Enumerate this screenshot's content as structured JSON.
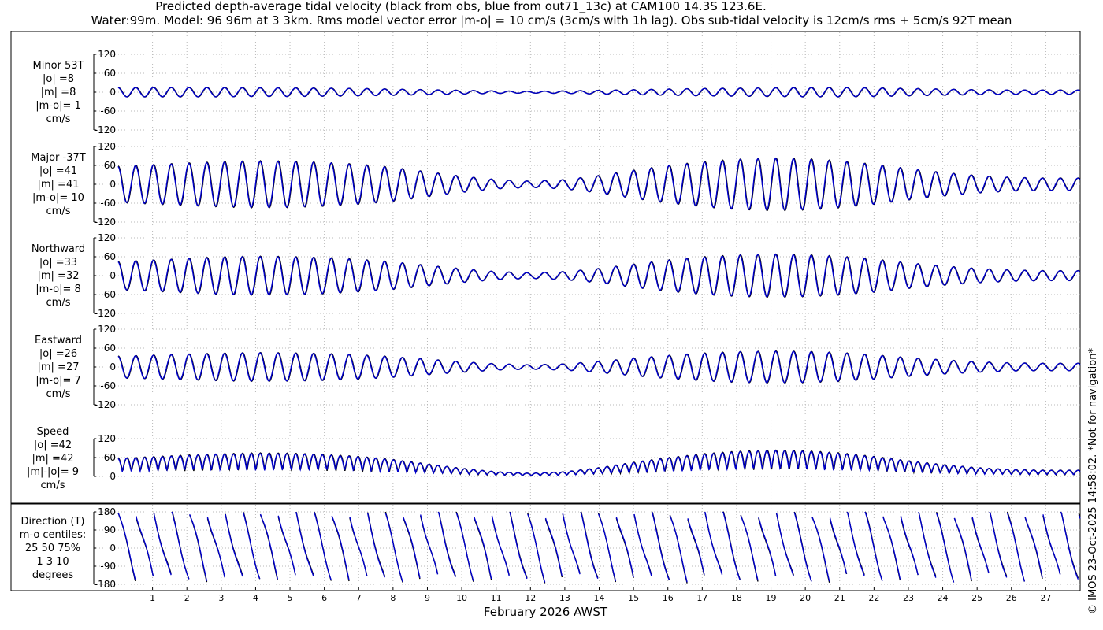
{
  "title_line1": "Predicted depth-average tidal velocity (black from obs, blue from out71_13c) at CAM100 14.3S 123.6E.",
  "title_line2": "Water:99m. Model: 96 96m at 3 3km. Rms model vector error |m-o| = 10 cm/s (3cm/s with 1h lag). Obs sub-tidal velocity is 12cm/s rms + 5cm/s 92T mean",
  "credit": "© IMOS 23-Oct-2025 14:58:02. *Not for navigation*",
  "panels": [
    {
      "lines": [
        "Minor 53T",
        "|o| =8",
        "|m| =8",
        "|m-o|= 1",
        "cm/s"
      ]
    },
    {
      "lines": [
        "Major -37T",
        "|o| =41",
        "|m| =41",
        "|m-o|= 10",
        "cm/s"
      ]
    },
    {
      "lines": [
        "Northward",
        "|o| =33",
        "|m| =32",
        "|m-o|= 8",
        "cm/s"
      ]
    },
    {
      "lines": [
        "Eastward",
        "|o| =26",
        "|m| =27",
        "|m-o|= 7",
        "cm/s"
      ]
    },
    {
      "lines": [
        "Speed",
        "|o| =42",
        "|m| =42",
        "|m|-|o|= 9",
        "cm/s"
      ]
    },
    {
      "lines": [
        "Direction (T)",
        "m-o centiles:",
        "25  50  75%",
        "1   3  10",
        "degrees"
      ]
    }
  ],
  "chart_data": {
    "type": "line",
    "xlabel": "February 2026 AWST",
    "xlim": [
      0,
      28
    ],
    "x_ticks": [
      "1",
      "2",
      "3",
      "4",
      "5",
      "6",
      "7",
      "8",
      "9",
      "10",
      "11",
      "12",
      "13",
      "14",
      "15",
      "16",
      "17",
      "18",
      "19",
      "20",
      "21",
      "22",
      "23",
      "24",
      "25",
      "26",
      "27"
    ],
    "series": [
      {
        "name": "obs",
        "color": "#000000"
      },
      {
        "name": "model out71_13c",
        "color": "#0000cc"
      }
    ],
    "panels": [
      {
        "name": "Minor 53T",
        "ylim": [
          -120,
          120
        ],
        "yticks": [
          120,
          60,
          0,
          -60,
          -120
        ],
        "amplitude_by_day": [
          15,
          15,
          15,
          15,
          14,
          14,
          13,
          12,
          10,
          8,
          6,
          4,
          3,
          4,
          6,
          8,
          10,
          12,
          13,
          14,
          15,
          15,
          14,
          12,
          10,
          8,
          7,
          7,
          7
        ]
      },
      {
        "name": "Major -37T",
        "ylim": [
          -120,
          120
        ],
        "yticks": [
          120,
          60,
          0,
          -60,
          -120
        ],
        "amplitude_by_day": [
          58,
          63,
          68,
          72,
          75,
          74,
          70,
          64,
          54,
          40,
          26,
          15,
          10,
          15,
          28,
          45,
          60,
          72,
          80,
          84,
          82,
          75,
          64,
          50,
          38,
          28,
          22,
          20,
          20
        ]
      },
      {
        "name": "Northward",
        "ylim": [
          -120,
          120
        ],
        "yticks": [
          120,
          60,
          0,
          -60,
          -120
        ],
        "amplitude_by_day": [
          45,
          50,
          55,
          60,
          62,
          61,
          58,
          52,
          44,
          33,
          22,
          13,
          9,
          13,
          23,
          37,
          50,
          60,
          66,
          69,
          67,
          62,
          53,
          41,
          31,
          23,
          18,
          16,
          16
        ]
      },
      {
        "name": "Eastward",
        "ylim": [
          -120,
          120
        ],
        "yticks": [
          120,
          60,
          0,
          -60,
          -120
        ],
        "amplitude_by_day": [
          35,
          38,
          41,
          44,
          46,
          45,
          43,
          39,
          33,
          25,
          17,
          10,
          7,
          10,
          18,
          28,
          37,
          44,
          49,
          51,
          50,
          46,
          39,
          30,
          23,
          17,
          13,
          12,
          12
        ]
      },
      {
        "name": "Speed",
        "ylim": [
          0,
          120
        ],
        "yticks": [
          120,
          60,
          0
        ],
        "amplitude_by_day": [
          58,
          63,
          68,
          72,
          75,
          74,
          70,
          64,
          54,
          40,
          26,
          15,
          10,
          15,
          28,
          45,
          60,
          72,
          80,
          84,
          82,
          75,
          64,
          50,
          38,
          28,
          22,
          20,
          20
        ]
      },
      {
        "name": "Direction (T)",
        "ylim": [
          -180,
          180
        ],
        "yticks": [
          180,
          90,
          0,
          -90,
          -180
        ]
      }
    ]
  }
}
